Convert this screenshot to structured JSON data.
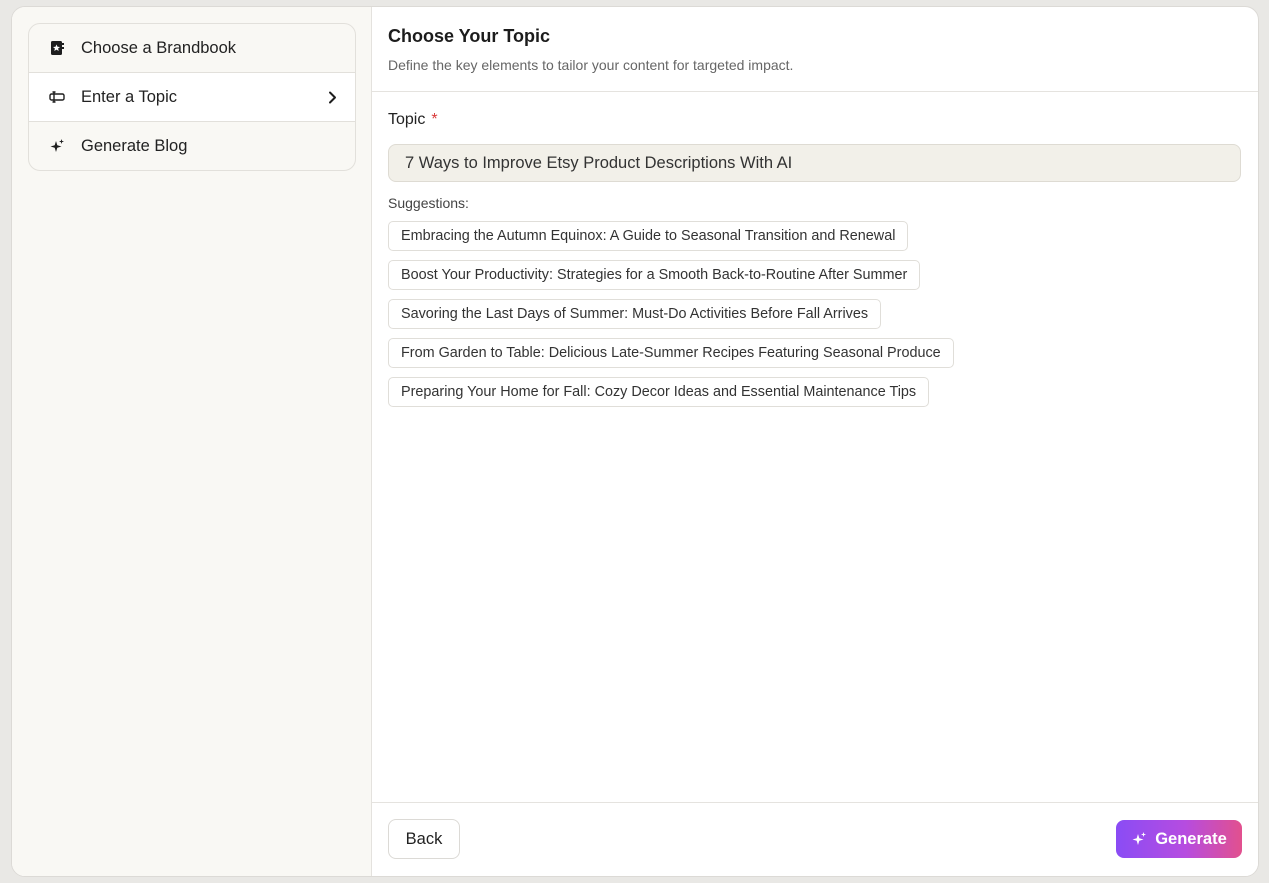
{
  "sidebar": {
    "steps": [
      {
        "label": "Choose a Brandbook",
        "icon": "brandbook-icon"
      },
      {
        "label": "Enter a Topic",
        "icon": "topic-icon",
        "active": true
      },
      {
        "label": "Generate Blog",
        "icon": "sparkle-icon"
      }
    ]
  },
  "header": {
    "title": "Choose Your Topic",
    "subtitle": "Define the key elements to tailor your content for targeted impact."
  },
  "form": {
    "topic_label": "Topic",
    "required_mark": "*",
    "topic_value": "7 Ways to Improve Etsy Product Descriptions With AI",
    "suggestions_label": "Suggestions:",
    "suggestions": [
      "Embracing the Autumn Equinox: A Guide to Seasonal Transition and Renewal",
      "Boost Your Productivity: Strategies for a Smooth Back-to-Routine After Summer",
      "Savoring the Last Days of Summer: Must-Do Activities Before Fall Arrives",
      "From Garden to Table: Delicious Late-Summer Recipes Featuring Seasonal Produce",
      "Preparing Your Home for Fall: Cozy Decor Ideas and Essential Maintenance Tips"
    ]
  },
  "footer": {
    "back_label": "Back",
    "generate_label": "Generate"
  },
  "colors": {
    "accent_gradient_start": "#8a4cf5",
    "accent_gradient_end": "#e2508e",
    "required": "#d93a3a"
  }
}
